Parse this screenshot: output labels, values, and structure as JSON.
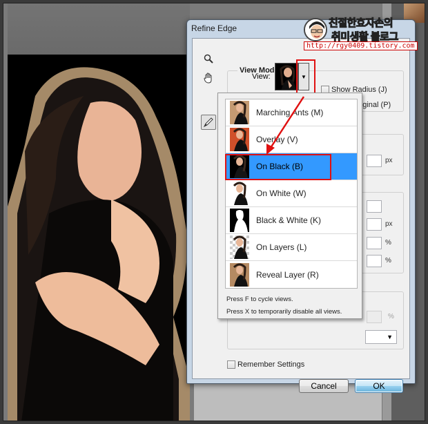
{
  "dialog": {
    "title": "Refine Edge",
    "view_mode": {
      "group_title": "View Mode",
      "view_label": "View:",
      "show_radius": "Show Radius (J)",
      "show_original": "Show Original (P)"
    },
    "units": {
      "px1": "px",
      "px2": "px",
      "pct1": "%",
      "pct2": "%",
      "pct3": "%"
    },
    "remember_settings": "Remember Settings",
    "cancel_label": "Cancel",
    "ok_label": "OK"
  },
  "menu": {
    "items": [
      {
        "label": "Marching Ants (M)",
        "thumb": "marching-ants"
      },
      {
        "label": "Overlay (V)",
        "thumb": "overlay"
      },
      {
        "label": "On Black (B)",
        "thumb": "on-black",
        "selected": true
      },
      {
        "label": "On White (W)",
        "thumb": "on-white"
      },
      {
        "label": "Black & White (K)",
        "thumb": "black-white"
      },
      {
        "label": "On Layers (L)",
        "thumb": "on-layers"
      },
      {
        "label": "Reveal Layer (R)",
        "thumb": "reveal-layer"
      }
    ],
    "hint1": "Press F to cycle views.",
    "hint2": "Press X to temporarily disable all views."
  },
  "watermark": {
    "line1": "친절한효자손의",
    "line2": "취미생활 블로그",
    "url": "http://rgy0409.tistory.com"
  },
  "colors": {
    "selection": "#3399ff",
    "annotation": "#e01010"
  }
}
